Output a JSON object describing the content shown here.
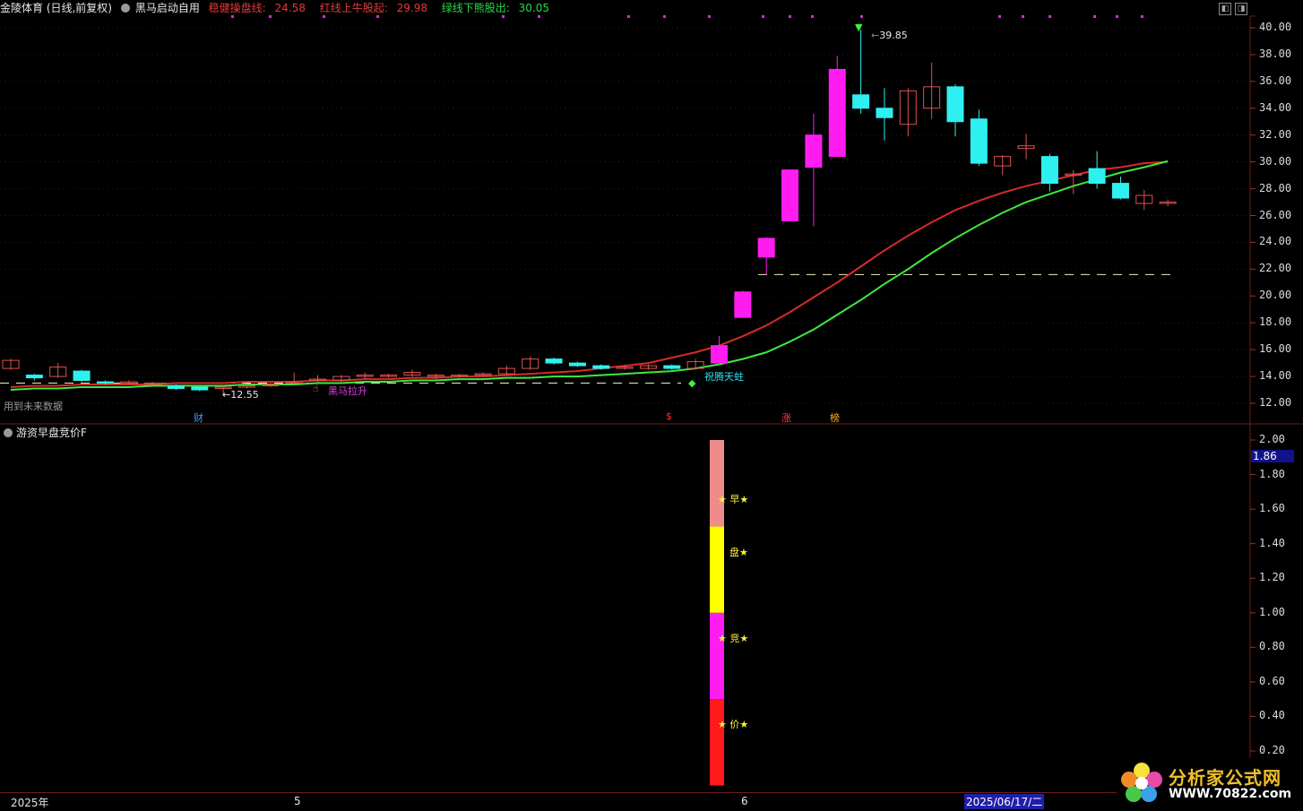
{
  "header": {
    "stock_name": "金陵体育 (日线,前复权)",
    "indicator_name": "黑马启动自用",
    "stable_label": "稳健操盘线:",
    "stable_value": "24.58",
    "red_label": "红线上牛股起:",
    "red_value": "29.98",
    "green_label": "绿线下熊股出:",
    "green_value": "30.05"
  },
  "main_axis": {
    "labels": [
      "40.00",
      "38.00",
      "36.00",
      "34.00",
      "32.00",
      "30.00",
      "28.00",
      "26.00",
      "24.00",
      "22.00",
      "20.00",
      "18.00",
      "16.00",
      "14.00",
      "12.00"
    ]
  },
  "annotations": {
    "high": "39.85",
    "low": "12.55",
    "future_note": "用到未来数据",
    "black_horse": "黑马拉升",
    "dragon": "祝腾天蛀",
    "markers": [
      "财",
      "$",
      "涨",
      "榜"
    ]
  },
  "sub_panel": {
    "title": "游资早盘竞价F",
    "axis_labels": [
      "2.00",
      "1.80",
      "1.60",
      "1.40",
      "1.20",
      "1.00",
      "0.80",
      "0.60",
      "0.40",
      "0.20"
    ],
    "current_value": "1.86",
    "bar_labels": [
      "★ 早★",
      "盘★",
      "★ 竞★",
      "★ 价★"
    ]
  },
  "bottom_axis": {
    "labels": [
      "2025年",
      "5",
      "6"
    ],
    "cursor_date": "2025/06/17/二"
  },
  "logo": {
    "title": "分析家公式网",
    "url": "WWW.70822.com"
  },
  "colors": {
    "up": "#ff1cf0",
    "down": "#2ef0f0",
    "red_line": "#d92a2a",
    "green_line": "#3ee83e",
    "divider": "#6b1e1e"
  },
  "chart_data": {
    "type": "candlestick",
    "ylim": [
      11,
      41
    ],
    "candles": [
      {
        "o": 14.6,
        "c": 15.2,
        "h": 15.3,
        "l": 14.5
      },
      {
        "o": 14.1,
        "c": 13.9,
        "h": 14.2,
        "l": 13.7
      },
      {
        "o": 14.0,
        "c": 14.7,
        "h": 15.0,
        "l": 13.9
      },
      {
        "o": 14.4,
        "c": 13.7,
        "h": 14.5,
        "l": 13.6
      },
      {
        "o": 13.6,
        "c": 13.5,
        "h": 13.7,
        "l": 13.4
      },
      {
        "o": 13.5,
        "c": 13.6,
        "h": 13.7,
        "l": 13.4
      },
      {
        "o": 13.5,
        "c": 13.5,
        "h": 13.6,
        "l": 13.4
      },
      {
        "o": 13.3,
        "c": 13.1,
        "h": 13.4,
        "l": 13.0
      },
      {
        "o": 13.2,
        "c": 13.0,
        "h": 13.3,
        "l": 12.9
      },
      {
        "o": 13.1,
        "c": 13.2,
        "h": 13.3,
        "l": 12.55
      },
      {
        "o": 13.2,
        "c": 13.3,
        "h": 13.4,
        "l": 13.1
      },
      {
        "o": 13.3,
        "c": 13.4,
        "h": 13.5,
        "l": 13.2
      },
      {
        "o": 13.5,
        "c": 13.6,
        "h": 14.3,
        "l": 13.4
      },
      {
        "o": 13.7,
        "c": 13.8,
        "h": 14.1,
        "l": 13.5
      },
      {
        "o": 13.7,
        "c": 14.0,
        "h": 14.1,
        "l": 13.5
      },
      {
        "o": 14.0,
        "c": 14.1,
        "h": 14.3,
        "l": 13.8
      },
      {
        "o": 14.0,
        "c": 14.1,
        "h": 14.2,
        "l": 13.9
      },
      {
        "o": 14.1,
        "c": 14.3,
        "h": 14.5,
        "l": 14.0
      },
      {
        "o": 14.0,
        "c": 14.1,
        "h": 14.2,
        "l": 13.8
      },
      {
        "o": 14.0,
        "c": 14.1,
        "h": 14.2,
        "l": 13.9
      },
      {
        "o": 14.1,
        "c": 14.2,
        "h": 14.3,
        "l": 14.0
      },
      {
        "o": 14.2,
        "c": 14.6,
        "h": 14.8,
        "l": 14.1
      },
      {
        "o": 14.6,
        "c": 15.3,
        "h": 15.5,
        "l": 14.5
      },
      {
        "o": 15.3,
        "c": 15.0,
        "h": 15.4,
        "l": 14.9
      },
      {
        "o": 15.0,
        "c": 14.8,
        "h": 15.1,
        "l": 14.7
      },
      {
        "o": 14.8,
        "c": 14.6,
        "h": 14.9,
        "l": 14.5
      },
      {
        "o": 14.6,
        "c": 14.7,
        "h": 14.8,
        "l": 14.5
      },
      {
        "o": 14.6,
        "c": 14.8,
        "h": 14.9,
        "l": 14.5
      },
      {
        "o": 14.8,
        "c": 14.6,
        "h": 14.9,
        "l": 14.5
      },
      {
        "o": 14.6,
        "c": 15.1,
        "h": 15.3,
        "l": 14.5
      },
      {
        "o": 15.0,
        "c": 16.3,
        "h": 17.0,
        "l": 14.9
      },
      {
        "o": 18.4,
        "c": 20.3,
        "h": 20.4,
        "l": 18.4
      },
      {
        "o": 22.9,
        "c": 24.3,
        "h": 24.4,
        "l": 21.6
      },
      {
        "o": 25.6,
        "c": 29.4,
        "h": 29.4,
        "l": 25.6
      },
      {
        "o": 29.6,
        "c": 32.0,
        "h": 33.6,
        "l": 25.2
      },
      {
        "o": 30.4,
        "c": 36.9,
        "h": 37.9,
        "l": 30.4
      },
      {
        "o": 35.0,
        "c": 34.0,
        "h": 39.85,
        "l": 33.6
      },
      {
        "o": 34.0,
        "c": 33.3,
        "h": 35.5,
        "l": 31.6
      },
      {
        "o": 32.8,
        "c": 35.3,
        "h": 35.5,
        "l": 31.9
      },
      {
        "o": 34.0,
        "c": 35.6,
        "h": 37.4,
        "l": 33.2
      },
      {
        "o": 35.6,
        "c": 33.0,
        "h": 35.8,
        "l": 31.9
      },
      {
        "o": 33.2,
        "c": 29.9,
        "h": 33.9,
        "l": 29.7
      },
      {
        "o": 29.7,
        "c": 30.4,
        "h": 30.5,
        "l": 29.0
      },
      {
        "o": 31.0,
        "c": 31.2,
        "h": 32.1,
        "l": 30.2
      },
      {
        "o": 30.4,
        "c": 28.4,
        "h": 30.6,
        "l": 27.8
      },
      {
        "o": 29.0,
        "c": 29.1,
        "h": 29.4,
        "l": 27.6
      },
      {
        "o": 29.5,
        "c": 28.4,
        "h": 30.8,
        "l": 28.0
      },
      {
        "o": 28.4,
        "c": 27.3,
        "h": 28.9,
        "l": 27.2
      },
      {
        "o": 26.9,
        "c": 27.5,
        "h": 27.9,
        "l": 26.4
      },
      {
        "o": 27.0,
        "c": 27.0,
        "h": 27.2,
        "l": 26.7
      }
    ],
    "red_line": [
      13.2,
      13.3,
      13.3,
      13.4,
      13.4,
      13.4,
      13.4,
      13.5,
      13.5,
      13.5,
      13.6,
      13.6,
      13.6,
      13.7,
      13.7,
      13.8,
      13.8,
      13.9,
      13.9,
      14.0,
      14.0,
      14.1,
      14.2,
      14.3,
      14.4,
      14.6,
      14.8,
      15.0,
      15.4,
      15.8,
      16.3,
      17.0,
      17.8,
      18.8,
      19.9,
      21.0,
      22.2,
      23.4,
      24.5,
      25.5,
      26.4,
      27.1,
      27.7,
      28.2,
      28.6,
      29.0,
      29.4,
      29.6,
      29.9,
      30.0
    ],
    "green_line": [
      13.0,
      13.1,
      13.1,
      13.2,
      13.2,
      13.2,
      13.3,
      13.3,
      13.3,
      13.3,
      13.4,
      13.4,
      13.4,
      13.5,
      13.5,
      13.6,
      13.6,
      13.7,
      13.7,
      13.8,
      13.8,
      13.9,
      13.9,
      14.0,
      14.0,
      14.1,
      14.2,
      14.3,
      14.4,
      14.6,
      14.9,
      15.3,
      15.8,
      16.6,
      17.5,
      18.6,
      19.7,
      20.9,
      22.0,
      23.2,
      24.3,
      25.3,
      26.2,
      27.0,
      27.6,
      28.2,
      28.7,
      29.2,
      29.6,
      30.05
    ],
    "support_lines": [
      {
        "y": 13.5,
        "label": ""
      },
      {
        "y": 21.6,
        "label": ""
      }
    ],
    "sub_bars": [
      {
        "from": 0.0,
        "to": 0.5,
        "color": "#ff1a1a"
      },
      {
        "from": 0.5,
        "to": 1.0,
        "color": "#ff1cf0"
      },
      {
        "from": 1.0,
        "to": 1.5,
        "color": "#ffff00"
      },
      {
        "from": 1.5,
        "to": 2.0,
        "color": "#f08b8b"
      }
    ],
    "sub_ylim": [
      0.1,
      2.1
    ]
  }
}
